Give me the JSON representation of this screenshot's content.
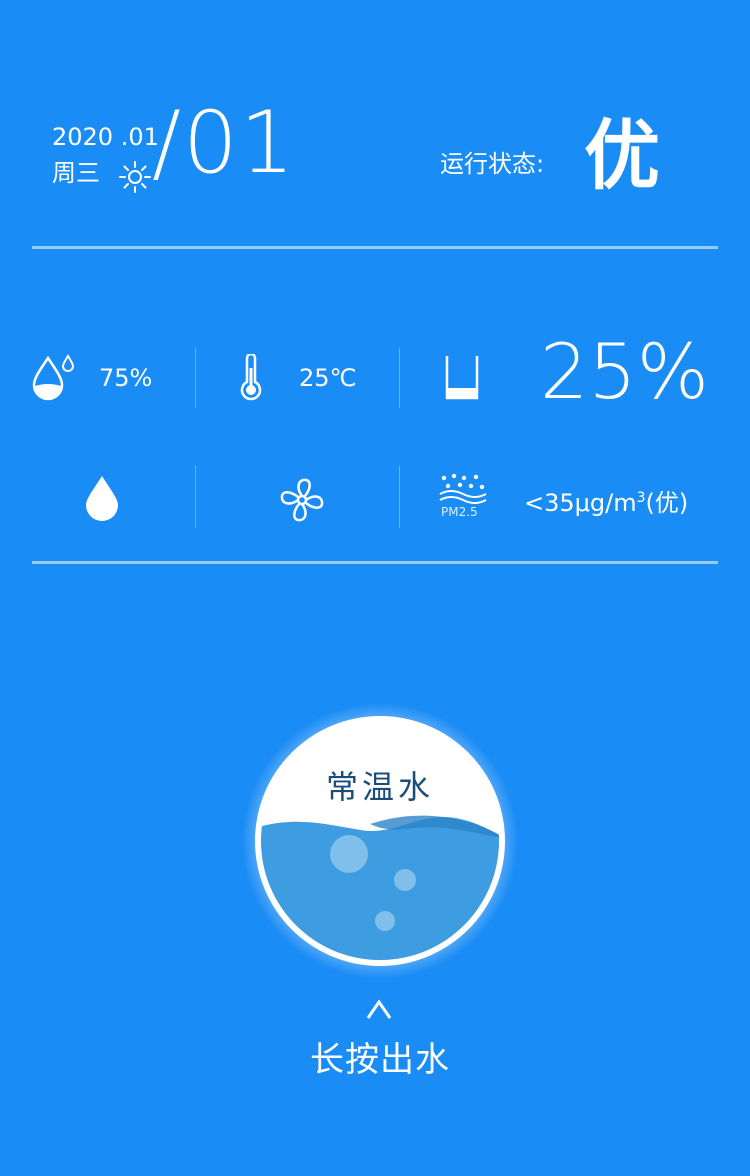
{
  "header": {
    "date": "2020 .01",
    "weekday": "周三",
    "day": "/01",
    "status_label": "运行状态:",
    "status_value": "优"
  },
  "metrics": {
    "humidity": "75%",
    "temperature": "25℃",
    "water_level": "25%",
    "pm25_badge": "PM2.5",
    "pm25_value_prefix": "<35μg/m",
    "pm25_value_sup": "3",
    "pm25_value_suffix": "(优)"
  },
  "water_button": {
    "label": "常温水",
    "hint": "长按出水",
    "arrow": "^"
  },
  "colors": {
    "background": "#1a8cf5",
    "water": "#3d9de0",
    "water_dark": "#2d83c8",
    "label": "#1b4d78"
  },
  "icons": [
    "humidity-icon",
    "thermometer-icon",
    "cup-icon",
    "water-drop-icon",
    "fan-icon",
    "pm25-icon",
    "sun-icon",
    "chevron-up-icon"
  ]
}
